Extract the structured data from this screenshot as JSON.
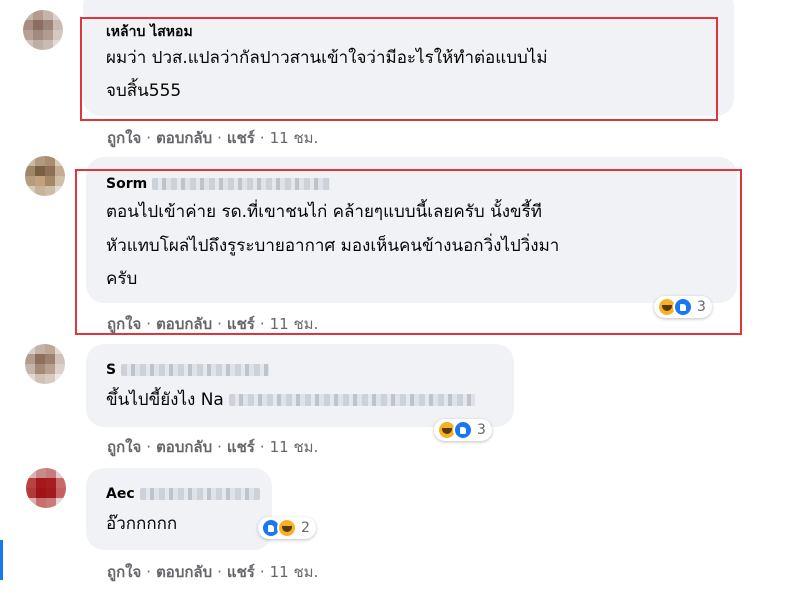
{
  "comments": [
    {
      "author": "เหล้าบ ไสหอม",
      "lines": [
        "ผมว่า ปวส.แปลว่ากัลปาวสานเข้าใจว่ามีอะไรให้ทำต่อแบบไม่",
        "จบสิ้น555"
      ],
      "actions": {
        "like": "ถูกใจ",
        "reply": "ตอบกลับ",
        "share": "แชร์",
        "time": "11 ชม."
      }
    },
    {
      "author": "Sorm",
      "lines": [
        "ตอนไปเข้าค่าย รด.ที่เขาชนไก่ คล้ายๆแบบนี้เลยครับ นั้งขรี้ที",
        "หัวแทบโผล่ไปถึงรูระบายอากาศ มองเห็นคนข้างนอกวิ่งไปวิ่งมา",
        "ครับ"
      ],
      "reactions": {
        "count": "3",
        "icons": [
          "haha-icon",
          "like-icon"
        ]
      },
      "actions": {
        "like": "ถูกใจ",
        "reply": "ตอบกลับ",
        "share": "แชร์",
        "time": "11 ชม."
      }
    },
    {
      "author": "S",
      "lines": [
        "ขึ้นไปขี้ยังไง Na"
      ],
      "reactions": {
        "count": "3",
        "icons": [
          "haha-icon",
          "like-icon"
        ]
      },
      "actions": {
        "like": "ถูกใจ",
        "reply": "ตอบกลับ",
        "share": "แชร์",
        "time": "11 ชม."
      }
    },
    {
      "author": "Aec",
      "lines": [
        "อ๊วกกกกก"
      ],
      "reactions": {
        "count": "2",
        "icons": [
          "like-icon",
          "haha-icon"
        ]
      },
      "actions": {
        "like": "ถูกใจ",
        "reply": "ตอบกลับ",
        "share": "แชร์",
        "time": "11 ชม."
      }
    }
  ],
  "colors": {
    "highlight": "#e0353b",
    "bubble": "#f0f2f5",
    "link": "#65676b"
  }
}
